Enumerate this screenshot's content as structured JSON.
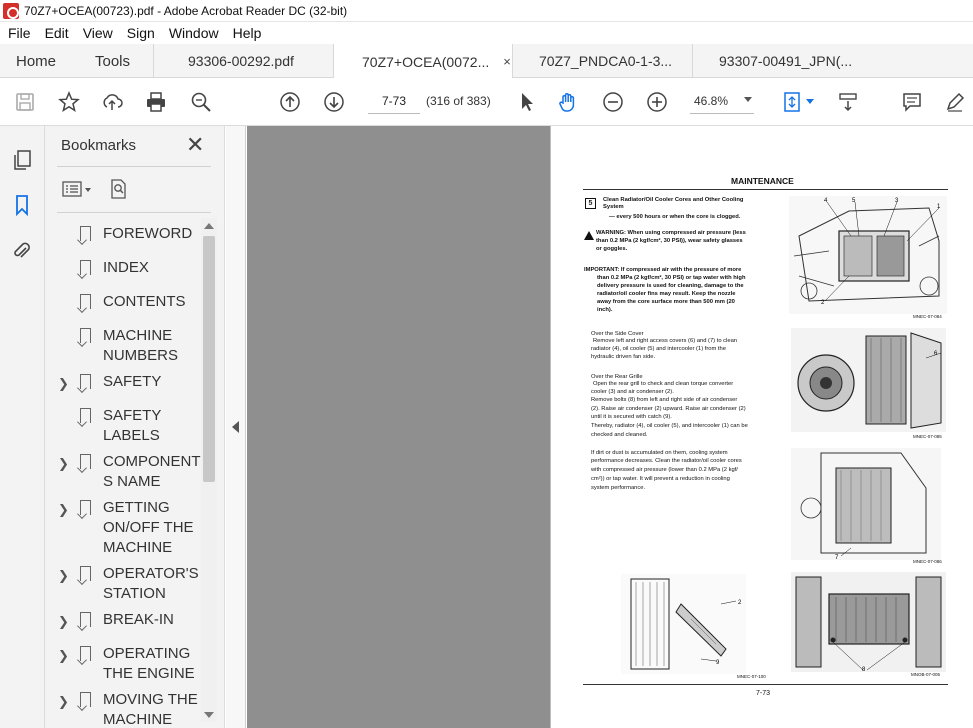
{
  "window": {
    "title": "70Z7+OCEA(00723).pdf - Adobe Acrobat Reader DC (32-bit)"
  },
  "menu": [
    "File",
    "Edit",
    "View",
    "Sign",
    "Window",
    "Help"
  ],
  "tabs": {
    "home": "Home",
    "tools": "Tools",
    "documents": [
      {
        "label": "93306-00292.pdf",
        "active": false
      },
      {
        "label": "70Z7+OCEA(0072...",
        "active": true,
        "close": "×"
      },
      {
        "label": "70Z7_PNDCA0-1-3...",
        "active": false
      },
      {
        "label": "93307-00491_JPN(...",
        "active": false
      }
    ]
  },
  "toolbar": {
    "page_input": "7-73",
    "page_count": "(316 of 383)",
    "zoom": "46.8%"
  },
  "bookmarks": {
    "title": "Bookmarks",
    "close": "✕",
    "items": [
      {
        "label": "FOREWORD",
        "expandable": false
      },
      {
        "label": "INDEX",
        "expandable": false
      },
      {
        "label": "CONTENTS",
        "expandable": false
      },
      {
        "label": "MACHINE NUMBERS",
        "expandable": false
      },
      {
        "label": "SAFETY",
        "expandable": true
      },
      {
        "label": "SAFETY LABELS",
        "expandable": false
      },
      {
        "label": "COMPONENT S NAME",
        "expandable": true
      },
      {
        "label": "GETTING ON/OFF THE MACHINE",
        "expandable": true
      },
      {
        "label": "OPERATOR'S STATION",
        "expandable": true
      },
      {
        "label": "BREAK-IN",
        "expandable": true
      },
      {
        "label": "OPERATING THE ENGINE",
        "expandable": true
      },
      {
        "label": "MOVING THE MACHINE",
        "expandable": true
      }
    ]
  },
  "page": {
    "header": "MAINTENANCE",
    "step_number": "5",
    "step_title_1": "Clean Radiator/Oil Cooler Cores and Other Cooling",
    "step_title_2": "System",
    "interval": "— every 500 hours or when the core is clogged.",
    "warning_1": "WARNING:   When using compressed air pressure (less",
    "warning_2": "than 0.2 MPa (2 kgf/cm², 30 PSI)), wear safety glasses",
    "warning_3": "or goggles.",
    "important_1": "IMPORTANT:   If compressed air with the pressure of more",
    "important_2": "than 0.2 MPa (2 kgf/cm², 30 PSI) or tap water with high",
    "important_3": "delivery pressure is used for cleaning, damage to the",
    "important_4": "radiator/oil cooler fins may result. Keep the nozzle",
    "important_5": "away from the core surface more than 500 mm (20",
    "important_6": "inch).",
    "side_cover_title": "Over the Side Cover",
    "side_cover_1": "Remove left and right access covers (6) and (7) to clean",
    "side_cover_2": "radiator (4), oil cooler (5) and intercooler (1) from the",
    "side_cover_3": "hydraulic driven fan side.",
    "rear_grille_title": "Over the Rear Grille",
    "rear_grille_1": "Open the rear grill to check and clean torque converter",
    "rear_grille_2": "cooler (3) and air condenser (2).",
    "rear_grille_3": "Remove bolts (8) from left and right side of air condenser",
    "rear_grille_4": "(2). Raise air condenser (2) upward. Raise air condenser (2)",
    "rear_grille_5": "until it is secured with catch (9).",
    "rear_grille_6": "Thereby, radiator (4), oil cooler (5), and intercooler (1) can be",
    "rear_grille_7": "checked and cleaned.",
    "dust_1": "If dirt or dust is accumulated on them, cooling system",
    "dust_2": "performance decreases. Clean the radiator/oil cooler cores",
    "dust_3": "with compressed air pressure (lower than 0.2 MPa (2 kgf/",
    "dust_4": "cm²)) or tap water. It will prevent a reduction in cooling",
    "dust_5": "system performance.",
    "fig_captions": [
      "MNEC-07-084",
      "MNEC-07-085",
      "MNEC-07-086",
      "MNEC-07-100",
      "MNOB-07-005"
    ],
    "page_number": "7-73"
  },
  "icons": {
    "save": "save-icon",
    "bookmark_star": "star-icon",
    "upload": "upload-icon",
    "print": "print-icon",
    "zoom_search": "zoom-search-icon",
    "prev_page": "arrow-up-circle-icon",
    "next_page": "arrow-down-circle-icon",
    "select": "cursor-icon",
    "hand": "hand-icon",
    "zoom_out": "zoom-out-icon",
    "zoom_in": "zoom-in-icon",
    "fit": "fit-page-icon",
    "scroll": "scroll-mode-icon",
    "comment": "comment-icon",
    "pen": "pen-icon"
  },
  "colors": {
    "accent": "#1473e6",
    "doc_bg": "#8f8f8f"
  }
}
